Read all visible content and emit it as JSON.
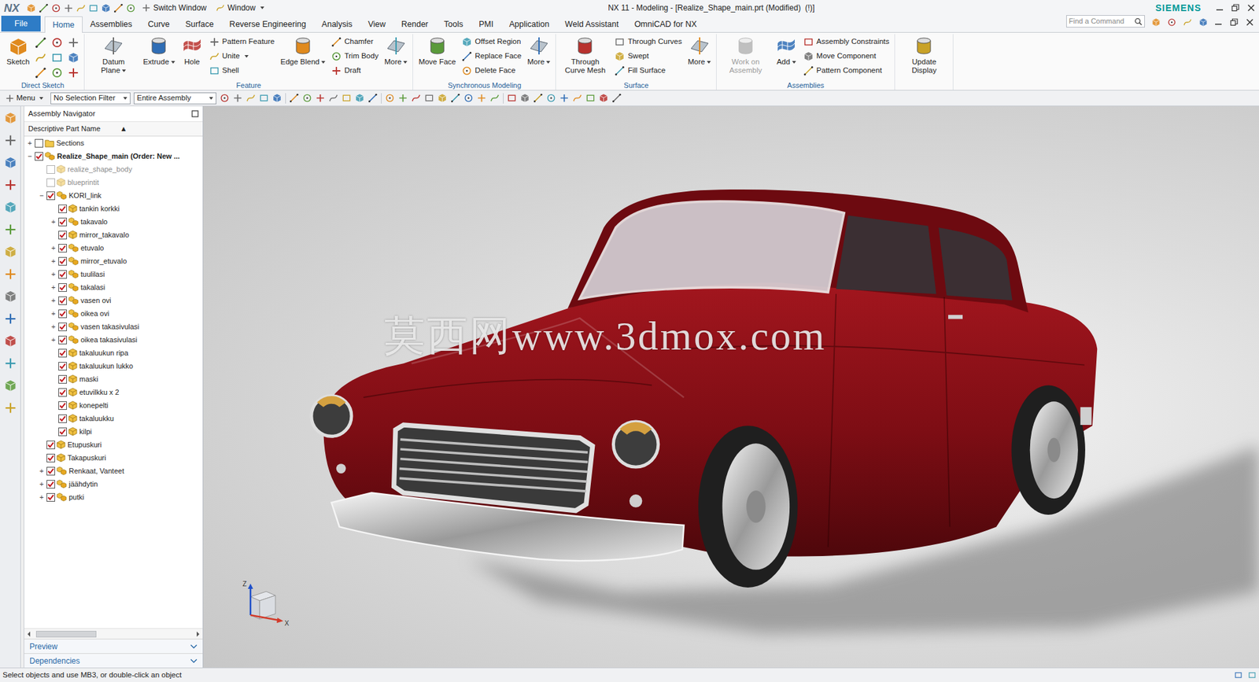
{
  "window": {
    "app": "NX",
    "title": "NX 11 - Modeling - [Realize_Shape_main.prt (Modified)  (!)]",
    "brand": "SIEMENS",
    "quick_access": [
      {
        "label": "Switch Window",
        "dropdown": false
      },
      {
        "label": "Window",
        "dropdown": true
      }
    ]
  },
  "file_button": {
    "label": "File"
  },
  "menu_tabs": [
    {
      "label": "Home",
      "selected": true
    },
    {
      "label": "Assemblies",
      "selected": false
    },
    {
      "label": "Curve",
      "selected": false
    },
    {
      "label": "Surface",
      "selected": false
    },
    {
      "label": "Reverse Engineering",
      "selected": false
    },
    {
      "label": "Analysis",
      "selected": false
    },
    {
      "label": "View",
      "selected": false
    },
    {
      "label": "Render",
      "selected": false
    },
    {
      "label": "Tools",
      "selected": false
    },
    {
      "label": "PMI",
      "selected": false
    },
    {
      "label": "Application",
      "selected": false
    },
    {
      "label": "Weld Assistant",
      "selected": false
    },
    {
      "label": "OmniCAD for NX",
      "selected": false
    }
  ],
  "search": {
    "placeholder": "Find a Command"
  },
  "ribbon": {
    "groups": [
      {
        "label": "Direct Sketch",
        "columns": [
          {
            "kind": "large",
            "items": [
              {
                "label": "Sketch",
                "dropdown": false,
                "disabled": false
              }
            ]
          },
          {
            "kind": "icon-grid",
            "items": []
          }
        ]
      },
      {
        "label": "Feature",
        "columns": [
          {
            "kind": "large",
            "items": [
              {
                "label": "Datum Plane",
                "dropdown": true,
                "disabled": false
              }
            ]
          },
          {
            "kind": "large",
            "items": [
              {
                "label": "Extrude",
                "dropdown": true,
                "disabled": false
              }
            ]
          },
          {
            "kind": "large",
            "items": [
              {
                "label": "Hole",
                "dropdown": false,
                "disabled": false
              }
            ]
          },
          {
            "kind": "stack",
            "items": [
              {
                "label": "Pattern Feature",
                "dropdown": false,
                "disabled": false
              },
              {
                "label": "Unite",
                "dropdown": true,
                "disabled": false
              },
              {
                "label": "Shell",
                "dropdown": false,
                "disabled": false
              }
            ]
          },
          {
            "kind": "large",
            "items": [
              {
                "label": "Edge Blend",
                "dropdown": true,
                "disabled": false
              }
            ]
          },
          {
            "kind": "stack",
            "items": [
              {
                "label": "Chamfer",
                "dropdown": false,
                "disabled": false
              },
              {
                "label": "Trim Body",
                "dropdown": false,
                "disabled": false
              },
              {
                "label": "Draft",
                "dropdown": false,
                "disabled": false
              }
            ]
          },
          {
            "kind": "large",
            "items": [
              {
                "label": "More",
                "dropdown": true,
                "disabled": false
              }
            ]
          }
        ]
      },
      {
        "label": "Synchronous Modeling",
        "columns": [
          {
            "kind": "large",
            "items": [
              {
                "label": "Move Face",
                "dropdown": false,
                "disabled": false
              }
            ]
          },
          {
            "kind": "stack",
            "items": [
              {
                "label": "Offset Region",
                "dropdown": false,
                "disabled": false
              },
              {
                "label": "Replace Face",
                "dropdown": false,
                "disabled": false
              },
              {
                "label": "Delete Face",
                "dropdown": false,
                "disabled": false
              }
            ]
          },
          {
            "kind": "large",
            "items": [
              {
                "label": "More",
                "dropdown": true,
                "disabled": false
              }
            ]
          }
        ]
      },
      {
        "label": "Surface",
        "columns": [
          {
            "kind": "large",
            "items": [
              {
                "label": "Through Curve Mesh",
                "dropdown": false,
                "disabled": false
              }
            ]
          },
          {
            "kind": "stack",
            "items": [
              {
                "label": "Through Curves",
                "dropdown": false,
                "disabled": false
              },
              {
                "label": "Swept",
                "dropdown": false,
                "disabled": false
              },
              {
                "label": "Fill Surface",
                "dropdown": false,
                "disabled": false
              }
            ]
          },
          {
            "kind": "large",
            "items": [
              {
                "label": "More",
                "dropdown": true,
                "disabled": false
              }
            ]
          }
        ]
      },
      {
        "label": "Assemblies",
        "columns": [
          {
            "kind": "large",
            "items": [
              {
                "label": "Work on Assembly",
                "dropdown": false,
                "disabled": true
              }
            ]
          },
          {
            "kind": "large",
            "items": [
              {
                "label": "Add",
                "dropdown": true,
                "disabled": false
              }
            ]
          },
          {
            "kind": "stack",
            "items": [
              {
                "label": "Assembly Constraints",
                "dropdown": false,
                "disabled": false
              },
              {
                "label": "Move Component",
                "dropdown": false,
                "disabled": false
              },
              {
                "label": "Pattern Component",
                "dropdown": false,
                "disabled": false
              }
            ]
          }
        ]
      },
      {
        "columns": [
          {
            "kind": "large",
            "items": [
              {
                "label": "Update Display",
                "dropdown": false,
                "disabled": false
              }
            ]
          }
        ]
      }
    ]
  },
  "selection_bar": {
    "menu": "Menu",
    "menu_dropdown": true,
    "filter": "No Selection Filter",
    "scope": "Entire Assembly"
  },
  "navigator": {
    "title": "Assembly Navigator",
    "column": "Descriptive Part Name",
    "sort": "▲",
    "rows": [
      {
        "label": "Sections",
        "level": 0,
        "expander": "+",
        "checked": false,
        "emphasis": "none",
        "kind": "folder"
      },
      {
        "label": "Realize_Shape_main (Order: New ...",
        "level": 0,
        "expander": "−",
        "checked": true,
        "emphasis": "bold",
        "kind": "assembly"
      },
      {
        "label": "realize_shape_body",
        "level": 1,
        "expander": "",
        "checked": false,
        "emphasis": "grey",
        "kind": "part"
      },
      {
        "label": "blueprintit",
        "level": 1,
        "expander": "",
        "checked": false,
        "emphasis": "grey",
        "kind": "part"
      },
      {
        "label": "KORI_link",
        "level": 1,
        "expander": "−",
        "checked": true,
        "emphasis": "none",
        "kind": "assembly"
      },
      {
        "label": "tankin korkki",
        "level": 2,
        "expander": "",
        "checked": true,
        "emphasis": "none",
        "kind": "part"
      },
      {
        "label": "takavalo",
        "level": 2,
        "expander": "+",
        "checked": true,
        "emphasis": "none",
        "kind": "assembly"
      },
      {
        "label": "mirror_takavalo",
        "level": 2,
        "expander": "",
        "checked": true,
        "emphasis": "none",
        "kind": "part"
      },
      {
        "label": "etuvalo",
        "level": 2,
        "expander": "+",
        "checked": true,
        "emphasis": "none",
        "kind": "assembly"
      },
      {
        "label": "mirror_etuvalo",
        "level": 2,
        "expander": "+",
        "checked": true,
        "emphasis": "none",
        "kind": "assembly"
      },
      {
        "label": "tuulilasi",
        "level": 2,
        "expander": "+",
        "checked": true,
        "emphasis": "none",
        "kind": "assembly"
      },
      {
        "label": "takalasi",
        "level": 2,
        "expander": "+",
        "checked": true,
        "emphasis": "none",
        "kind": "assembly"
      },
      {
        "label": "vasen ovi",
        "level": 2,
        "expander": "+",
        "checked": true,
        "emphasis": "none",
        "kind": "assembly"
      },
      {
        "label": "oikea ovi",
        "level": 2,
        "expander": "+",
        "checked": true,
        "emphasis": "none",
        "kind": "assembly"
      },
      {
        "label": "vasen takasivulasi",
        "level": 2,
        "expander": "+",
        "checked": true,
        "emphasis": "none",
        "kind": "assembly"
      },
      {
        "label": "oikea takasivulasi",
        "level": 2,
        "expander": "+",
        "checked": true,
        "emphasis": "none",
        "kind": "assembly"
      },
      {
        "label": "takaluukun ripa",
        "level": 2,
        "expander": "",
        "checked": true,
        "emphasis": "none",
        "kind": "part"
      },
      {
        "label": "takaluukun lukko",
        "level": 2,
        "expander": "",
        "checked": true,
        "emphasis": "none",
        "kind": "part"
      },
      {
        "label": "maski",
        "level": 2,
        "expander": "",
        "checked": true,
        "emphasis": "none",
        "kind": "part"
      },
      {
        "label": "etuvilkku x 2",
        "level": 2,
        "expander": "",
        "checked": true,
        "emphasis": "none",
        "kind": "part"
      },
      {
        "label": "konepelti",
        "level": 2,
        "expander": "",
        "checked": true,
        "emphasis": "none",
        "kind": "part"
      },
      {
        "label": "takaluukku",
        "level": 2,
        "expander": "",
        "checked": true,
        "emphasis": "none",
        "kind": "part"
      },
      {
        "label": "kilpi",
        "level": 2,
        "expander": "",
        "checked": true,
        "emphasis": "none",
        "kind": "part"
      },
      {
        "label": "Etupuskuri",
        "level": 1,
        "expander": "",
        "checked": true,
        "emphasis": "none",
        "kind": "part"
      },
      {
        "label": "Takapuskuri",
        "level": 1,
        "expander": "",
        "checked": true,
        "emphasis": "none",
        "kind": "part"
      },
      {
        "label": "Renkaat, Vanteet",
        "level": 1,
        "expander": "+",
        "checked": true,
        "emphasis": "none",
        "kind": "assembly"
      },
      {
        "label": "jäähdytin",
        "level": 1,
        "expander": "+",
        "checked": true,
        "emphasis": "none",
        "kind": "assembly"
      },
      {
        "label": "putki",
        "level": 1,
        "expander": "+",
        "checked": true,
        "emphasis": "none",
        "kind": "assembly"
      }
    ],
    "sections": [
      {
        "label": "Preview"
      },
      {
        "label": "Dependencies"
      }
    ]
  },
  "viewport": {
    "watermark": "莫西网www.3dmox.com",
    "axes": [
      "Z",
      "X"
    ]
  },
  "status_bar": "Select objects and use MB3, or double-click an object"
}
